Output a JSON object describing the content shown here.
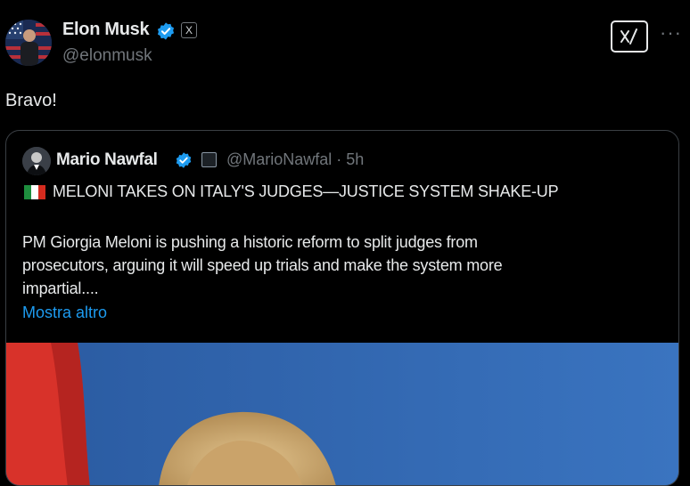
{
  "post": {
    "author_name": "Elon Musk",
    "author_handle": "@elonmusk",
    "text": "Bravo!",
    "grok_label": "x̷",
    "more_label": "···",
    "x_badge": "X"
  },
  "quote": {
    "author_name": "Mario Nawfal",
    "handle_time": "@MarioNawfal · 5h",
    "headline": "MELONI TAKES ON ITALY'S JUDGES—JUSTICE SYSTEM SHAKE-UP",
    "body_lines": [
      "PM Giorgia Meloni is pushing a historic reform to split judges from",
      "prosecutors, arguing it will speed up trials and make the system more",
      "impartial...."
    ],
    "show_more": "Mostra altro",
    "flag_colors": [
      "#1e8e3e",
      "#ffffff",
      "#d52b1e"
    ]
  },
  "colors": {
    "verified_blue": "#1d9bf0",
    "photo_background": "#2f63a8",
    "photo_flag_red": "#d8322a",
    "hair": "#c9a66b"
  }
}
